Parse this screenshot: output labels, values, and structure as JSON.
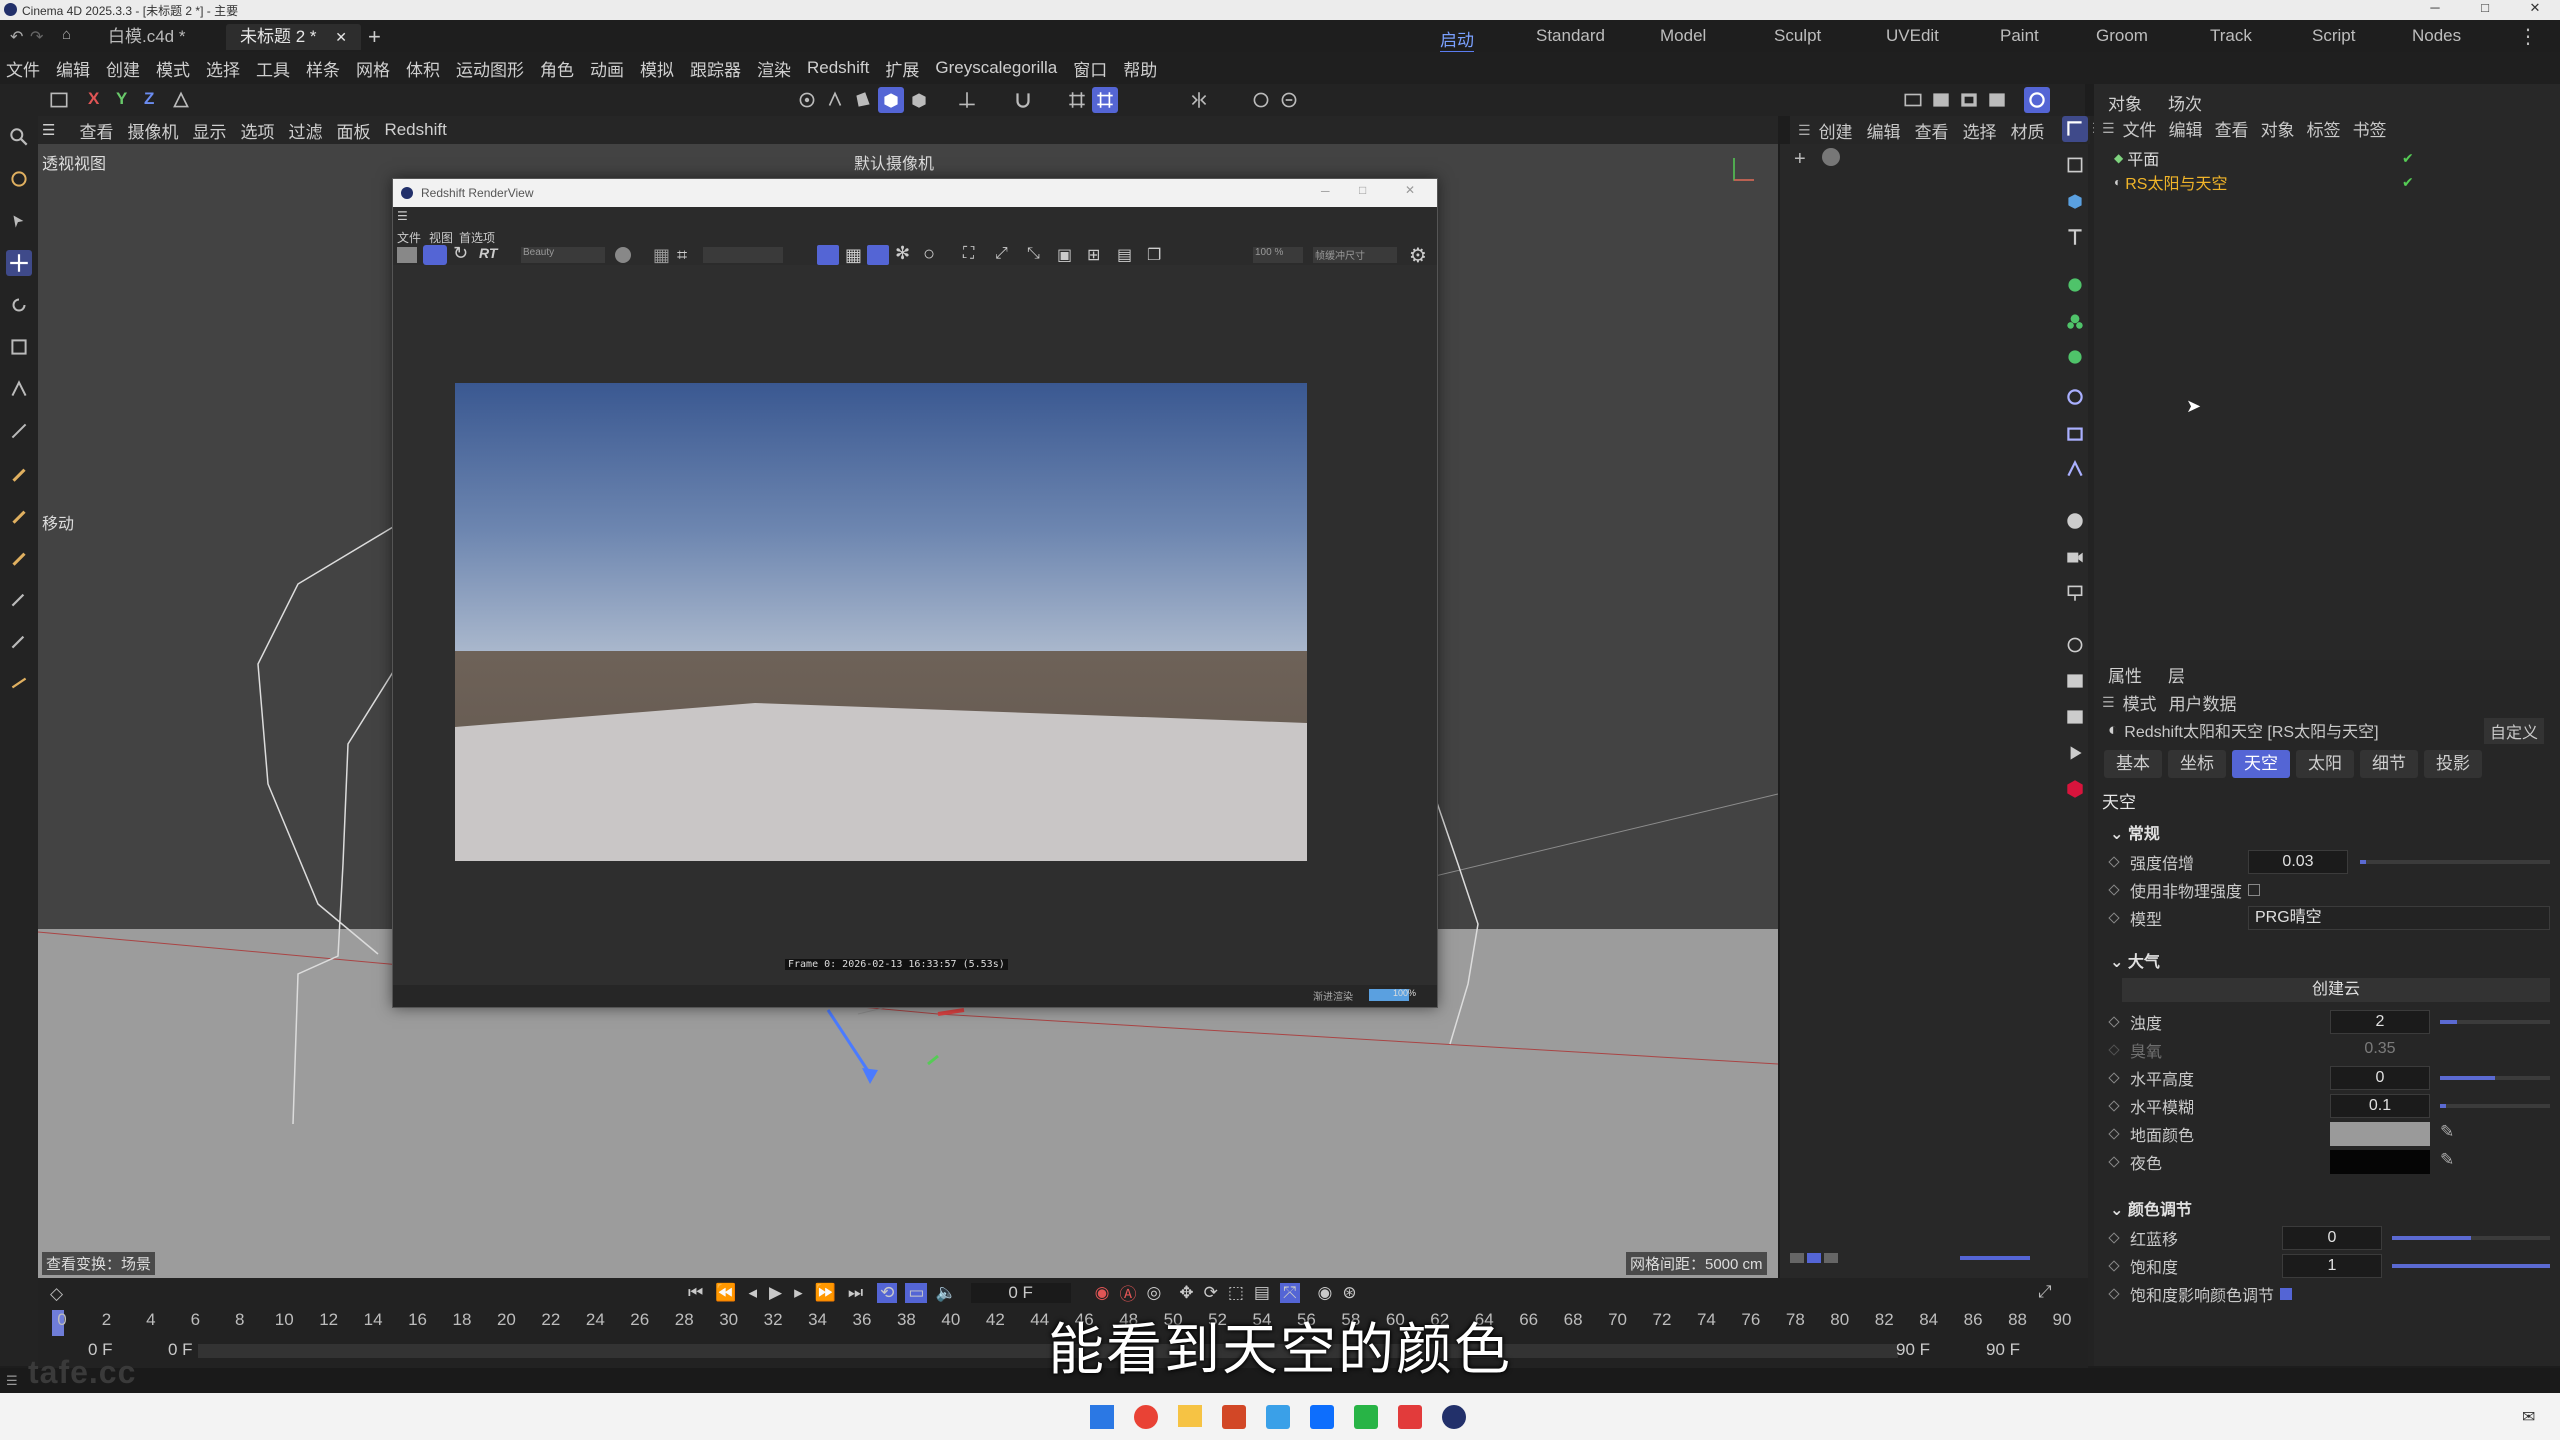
{
  "window": {
    "title": "Cinema 4D 2025.3.3 - [未标题 2 *] - 主要",
    "minimize": "─",
    "maximize": "□",
    "close": "✕"
  },
  "doc_tabs": [
    {
      "label": "白模.c4d *"
    },
    {
      "label": "未标题 2 *"
    }
  ],
  "layout_tabs": [
    "启动",
    "Standard",
    "Model",
    "Sculpt",
    "UVEdit",
    "Paint",
    "Groom",
    "Track",
    "Script",
    "Nodes"
  ],
  "menu": [
    "文件",
    "编辑",
    "创建",
    "模式",
    "选择",
    "工具",
    "样条",
    "网格",
    "体积",
    "运动图形",
    "角色",
    "动画",
    "模拟",
    "跟踪器",
    "渲染",
    "Redshift",
    "扩展",
    "Greyscalegorilla",
    "窗口",
    "帮助"
  ],
  "axis_buttons": [
    "X",
    "Y",
    "Z"
  ],
  "viewport": {
    "menu": [
      "查看",
      "摄像机",
      "显示",
      "选项",
      "过滤",
      "面板",
      "Redshift"
    ],
    "label": "透视视图",
    "camera": "默认摄像机",
    "move_hint": "移动",
    "status_left": "查看变换：场景",
    "grid_spacing": "网格间距：5000 cm"
  },
  "render_view": {
    "title": "Redshift RenderView",
    "menu": [
      "文件",
      "视图",
      "首选项"
    ],
    "aov": "Beauty",
    "zoom": "100 %",
    "size": "帧缓冲尺寸",
    "frame_info": "Frame  0:  2026-02-13  16:33:57  (5.53s)",
    "progress_label": "渐进渲染",
    "progress_pct": "100%"
  },
  "object_manager": {
    "tabs": [
      "对象",
      "场次"
    ],
    "menu": [
      "文件",
      "编辑",
      "查看",
      "对象",
      "标签",
      "书签"
    ],
    "objects": [
      {
        "name": "平面",
        "selected": false
      },
      {
        "name": "RS太阳与天空",
        "selected": true
      }
    ]
  },
  "scene_menu": [
    "创建",
    "编辑",
    "查看",
    "选择",
    "材质"
  ],
  "attributes": {
    "tabs": [
      "属性",
      "层"
    ],
    "mode_menu": [
      "模式",
      "用户数据"
    ],
    "object_title": "Redshift太阳和天空 [RS太阳与天空]",
    "custom": "自定义",
    "sub_tabs": [
      "基本",
      "坐标",
      "天空",
      "太阳",
      "细节",
      "投影"
    ],
    "active_sub_tab": "天空",
    "page_title": "天空",
    "general": {
      "title": "常规",
      "intensity_label": "强度倍增",
      "intensity": "0.03",
      "intensity_level": 0.03,
      "nonphys_label": "使用非物理强度",
      "model_label": "模型",
      "model": "PRG晴空"
    },
    "atmosphere": {
      "title": "大气",
      "create_cloud": "创建云",
      "turbidity_label": "浊度",
      "turbidity": "2",
      "ozone_label": "臭氧",
      "ozone": "0.35",
      "horizon_height_label": "水平高度",
      "horizon_height": "0",
      "horizon_blur_label": "水平模糊",
      "horizon_blur": "0.1",
      "ground_color_label": "地面颜色",
      "night_color_label": "夜色"
    },
    "color_adjust": {
      "title": "颜色调节",
      "redblue_label": "红蓝移",
      "redblue": "0",
      "saturation_label": "饱和度",
      "saturation": "1",
      "sat_affects_label": "饱和度影响颜色调节"
    }
  },
  "timeline": {
    "ticks": [
      "0",
      "2",
      "4",
      "6",
      "8",
      "10",
      "12",
      "14",
      "16",
      "18",
      "20",
      "22",
      "24",
      "26",
      "28",
      "30",
      "32",
      "34",
      "36",
      "38",
      "40",
      "42",
      "44",
      "46",
      "48",
      "50",
      "52",
      "54",
      "56",
      "58",
      "60",
      "62",
      "64",
      "66",
      "68",
      "70",
      "72",
      "74",
      "76",
      "78",
      "80",
      "82",
      "84",
      "86",
      "88",
      "90"
    ],
    "current_frame": "0 F",
    "start": "0 F",
    "start2": "0 F",
    "end": "90 F",
    "end2": "90 F"
  },
  "subtitle": "能看到天空的颜色",
  "watermark": "tafe.cc",
  "colors": {
    "accent": "#5465d5",
    "selected_object": "#f0b429",
    "sky_top": "#3a5891",
    "sky_horizon": "#a9b7cc",
    "ground_far": "#6b5f55",
    "floor": "#c9c6c6"
  }
}
